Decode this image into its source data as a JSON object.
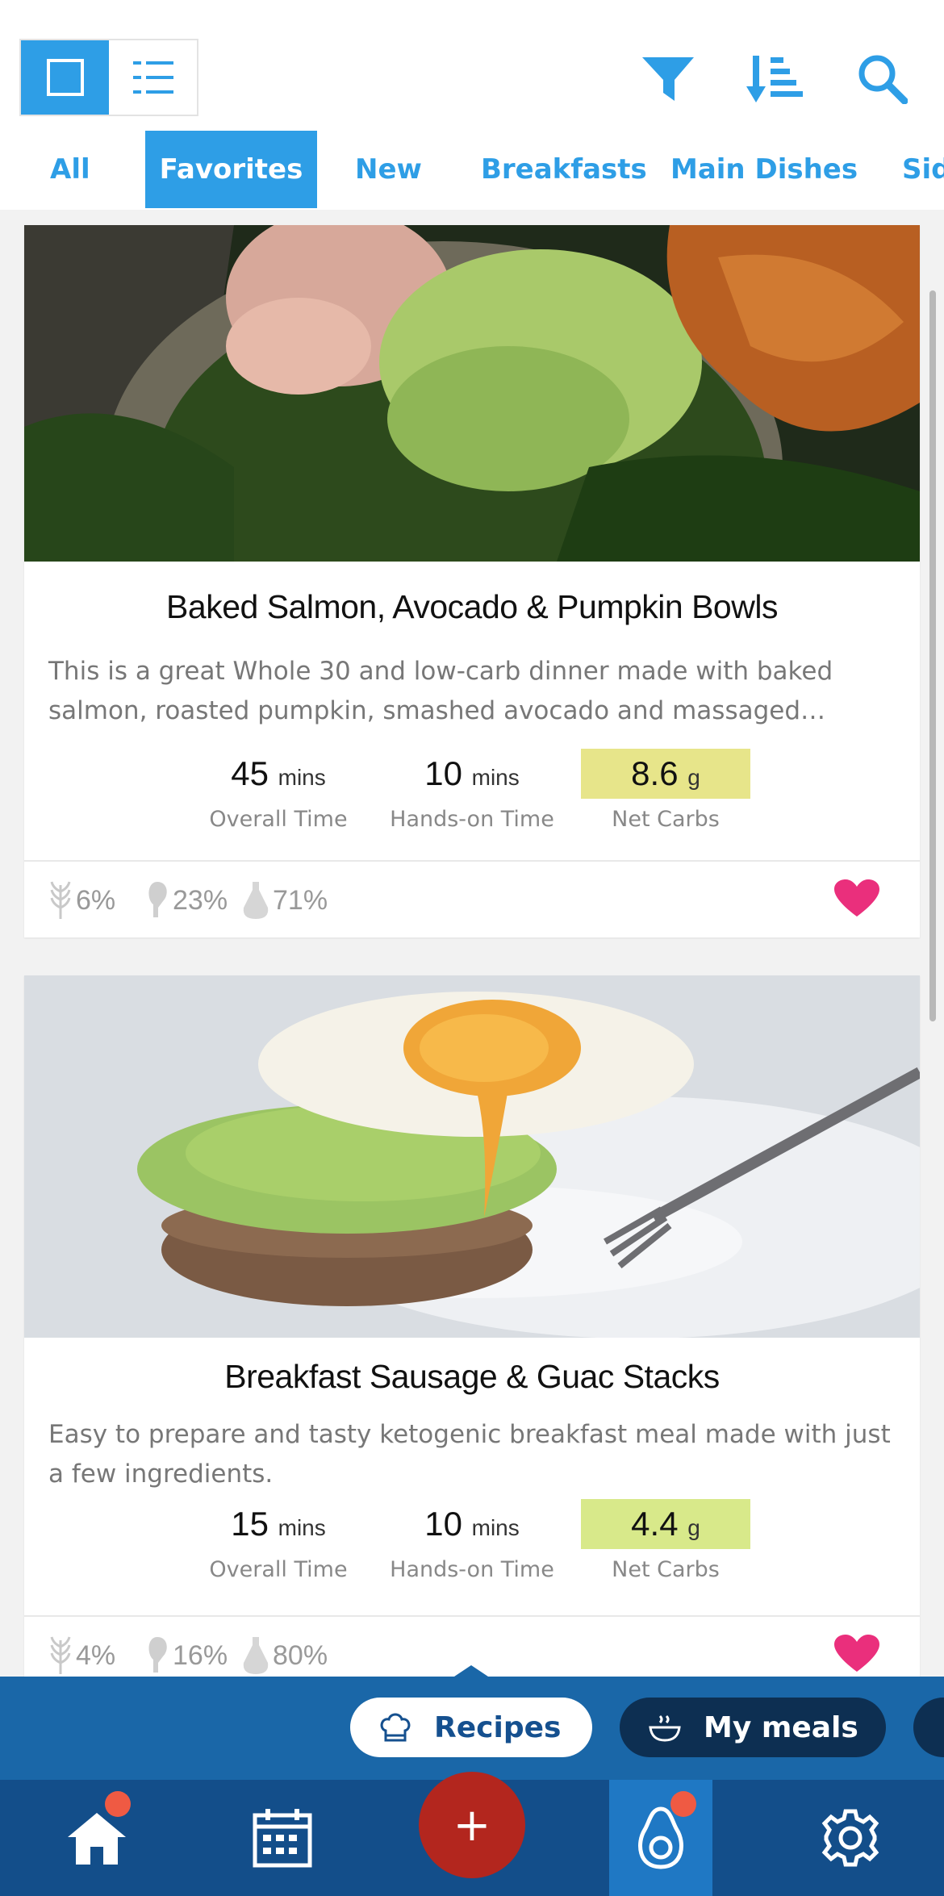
{
  "toolbar": {
    "view_modes": [
      "single-card-view",
      "list-view"
    ],
    "active_view": "single-card-view",
    "icons": [
      "filter-icon",
      "sort-icon",
      "search-icon"
    ],
    "accent": "#2e9ee6"
  },
  "tabs": [
    {
      "label": "All",
      "active": false
    },
    {
      "label": "Favorites",
      "active": true
    },
    {
      "label": "New",
      "active": false
    },
    {
      "label": "Breakfasts",
      "active": false
    },
    {
      "label": "Main Dishes",
      "active": false
    },
    {
      "label": "Sid",
      "active": false
    }
  ],
  "recipes": [
    {
      "title": "Baked Salmon, Avocado & Pumpkin Bowls",
      "description": "This is a great Whole 30 and low-carb dinner made with baked salmon, roasted pumpkin, smashed avocado and massaged…",
      "overall_time": "45",
      "overall_unit": "mins",
      "overall_label": "Overall Time",
      "hands_on_time": "10",
      "hands_on_unit": "mins",
      "hands_on_label": "Hands-on Time",
      "net_carbs": "8.6",
      "net_carbs_unit": "g",
      "net_carbs_label": "Net Carbs",
      "carbs_pct": "6%",
      "protein_pct": "23%",
      "fat_pct": "71%",
      "favorite": true
    },
    {
      "title": "Breakfast Sausage & Guac Stacks",
      "description": "Easy to prepare and tasty ketogenic breakfast meal made with just a few ingredients.",
      "overall_time": "15",
      "overall_unit": "mins",
      "overall_label": "Overall Time",
      "hands_on_time": "10",
      "hands_on_unit": "mins",
      "hands_on_label": "Hands-on Time",
      "net_carbs": "4.4",
      "net_carbs_unit": "g",
      "net_carbs_label": "Net Carbs",
      "carbs_pct": "4%",
      "protein_pct": "16%",
      "fat_pct": "80%",
      "favorite": true
    }
  ],
  "subnav": {
    "recipes_label": "Recipes",
    "meals_label": "My meals",
    "active": "Recipes"
  },
  "tabbar": {
    "items": [
      "home-icon",
      "calendar-icon",
      "add-button",
      "avocado-icon",
      "settings-icon"
    ],
    "active": "avocado-icon",
    "add_label": "+"
  }
}
